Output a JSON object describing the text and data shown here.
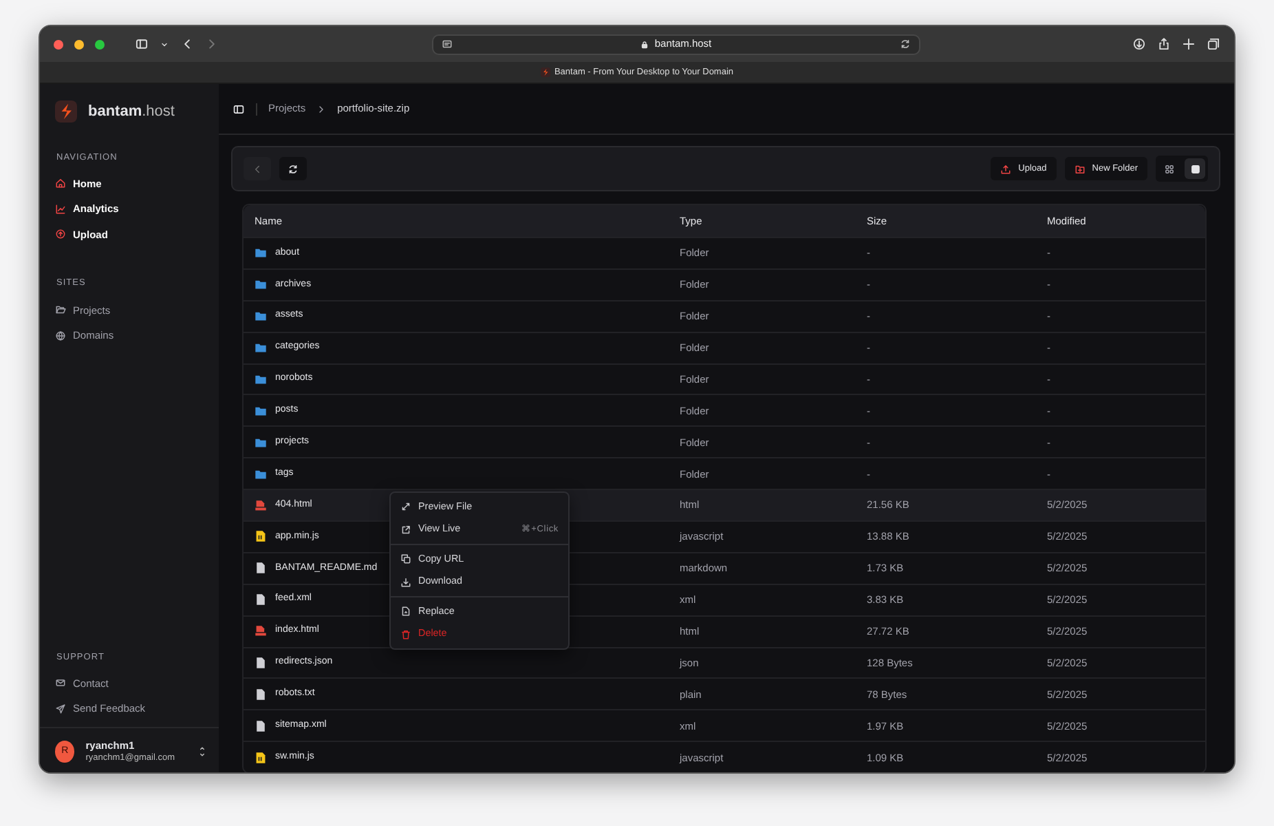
{
  "browser": {
    "url": "bantam.host",
    "tab_title": "Bantam - From Your Desktop to Your Domain"
  },
  "sidebar": {
    "brand": "bantam",
    "brand_suffix": ".host",
    "sections": [
      {
        "title": "NAVIGATION",
        "kind": "primary",
        "items": [
          {
            "label": "Home"
          },
          {
            "label": "Analytics"
          },
          {
            "label": "Upload"
          }
        ]
      },
      {
        "title": "SITES",
        "kind": "secondary",
        "items": [
          {
            "label": "Projects"
          },
          {
            "label": "Domains"
          }
        ]
      }
    ],
    "support": {
      "title": "SUPPORT",
      "items": [
        {
          "label": "Contact"
        },
        {
          "label": "Send Feedback"
        }
      ]
    },
    "user": {
      "initial": "R",
      "name": "ryanchm1",
      "email": "ryanchm1@gmail.com"
    }
  },
  "breadcrumb": [
    "Projects",
    "portfolio-site.zip"
  ],
  "toolbar": {
    "buttons": [
      {
        "label": "Upload"
      },
      {
        "label": "New Folder"
      }
    ],
    "views": [
      {
        "kind": "grid",
        "selected": false
      },
      {
        "kind": "list",
        "selected": true
      }
    ]
  },
  "table": {
    "columns": [
      "Name",
      "Type",
      "Size",
      "Modified"
    ],
    "rows": [
      {
        "kind": "folder",
        "name": "about",
        "type": "Folder",
        "size": "-",
        "modified": "-",
        "selected": false
      },
      {
        "kind": "folder",
        "name": "archives",
        "type": "Folder",
        "size": "-",
        "modified": "-",
        "selected": false
      },
      {
        "kind": "folder",
        "name": "assets",
        "type": "Folder",
        "size": "-",
        "modified": "-",
        "selected": false
      },
      {
        "kind": "folder",
        "name": "categories",
        "type": "Folder",
        "size": "-",
        "modified": "-",
        "selected": false
      },
      {
        "kind": "folder",
        "name": "norobots",
        "type": "Folder",
        "size": "-",
        "modified": "-",
        "selected": false
      },
      {
        "kind": "folder",
        "name": "posts",
        "type": "Folder",
        "size": "-",
        "modified": "-",
        "selected": false
      },
      {
        "kind": "folder",
        "name": "projects",
        "type": "Folder",
        "size": "-",
        "modified": "-",
        "selected": false
      },
      {
        "kind": "folder",
        "name": "tags",
        "type": "Folder",
        "size": "-",
        "modified": "-",
        "selected": false
      },
      {
        "kind": "html",
        "name": "404.html",
        "type": "html",
        "size": "21.56 KB",
        "modified": "5/2/2025",
        "selected": true
      },
      {
        "kind": "js",
        "name": "app.min.js",
        "type": "javascript",
        "size": "13.88 KB",
        "modified": "5/2/2025",
        "selected": false
      },
      {
        "kind": "file",
        "name": "BANTAM_README.md",
        "type": "markdown",
        "size": "1.73 KB",
        "modified": "5/2/2025",
        "selected": false
      },
      {
        "kind": "file",
        "name": "feed.xml",
        "type": "xml",
        "size": "3.83 KB",
        "modified": "5/2/2025",
        "selected": false
      },
      {
        "kind": "html",
        "name": "index.html",
        "type": "html",
        "size": "27.72 KB",
        "modified": "5/2/2025",
        "selected": false
      },
      {
        "kind": "file",
        "name": "redirects.json",
        "type": "json",
        "size": "128 Bytes",
        "modified": "5/2/2025",
        "selected": false
      },
      {
        "kind": "file",
        "name": "robots.txt",
        "type": "plain",
        "size": "78 Bytes",
        "modified": "5/2/2025",
        "selected": false
      },
      {
        "kind": "file",
        "name": "sitemap.xml",
        "type": "xml",
        "size": "1.97 KB",
        "modified": "5/2/2025",
        "selected": false
      },
      {
        "kind": "js",
        "name": "sw.min.js",
        "type": "javascript",
        "size": "1.09 KB",
        "modified": "5/2/2025",
        "selected": false
      }
    ]
  },
  "context_menu": {
    "groups": [
      [
        {
          "label": "Preview File",
          "kind": "normal"
        },
        {
          "label": "View Live",
          "kind": "normal",
          "shortcut": "⌘+Click"
        }
      ],
      [
        {
          "label": "Copy URL",
          "kind": "normal"
        },
        {
          "label": "Download",
          "kind": "normal"
        }
      ],
      [
        {
          "label": "Replace",
          "kind": "normal"
        },
        {
          "label": "Delete",
          "kind": "danger"
        }
      ]
    ]
  }
}
